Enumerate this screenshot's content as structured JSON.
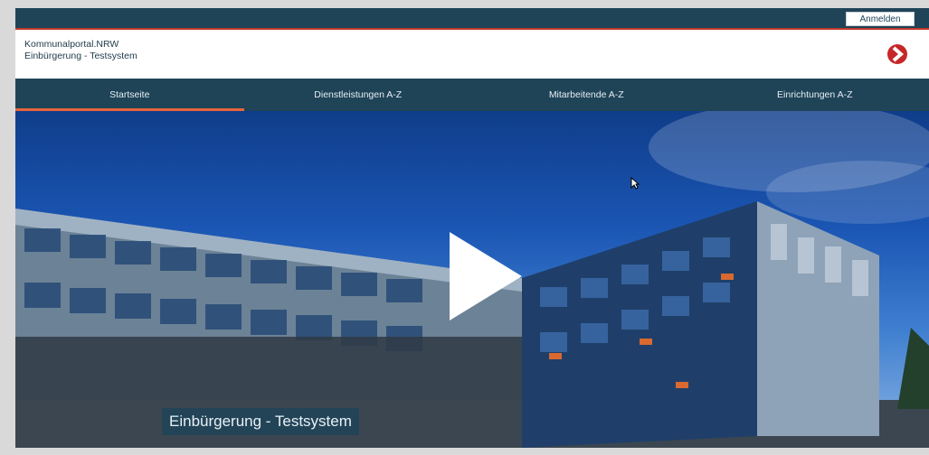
{
  "header": {
    "login_label": "Anmelden",
    "portal_name": "Kommunalportal.NRW",
    "portal_subtitle": "Einbürgerung - Testsystem",
    "logo_icon": "chevron-right-icon",
    "accent_color": "#c62828"
  },
  "nav": {
    "items": [
      {
        "label": "Startseite",
        "active": true
      },
      {
        "label": "Dienstleistungen A-Z",
        "active": false
      },
      {
        "label": "Mitarbeitende A-Z",
        "active": false
      },
      {
        "label": "Einrichtungen A-Z",
        "active": false
      }
    ],
    "active_indicator_color": "#e8643c"
  },
  "hero": {
    "caption": "Einbürgerung - Testsystem",
    "play_icon": "play-icon"
  },
  "colors": {
    "primary": "#1f4458",
    "background": "#ffffff"
  }
}
